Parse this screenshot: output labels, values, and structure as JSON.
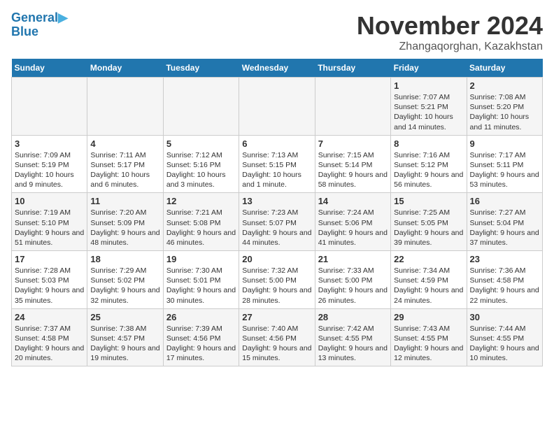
{
  "header": {
    "logo_line1": "General",
    "logo_line2": "Blue",
    "month": "November 2024",
    "location": "Zhangaqorghan, Kazakhstan"
  },
  "weekdays": [
    "Sunday",
    "Monday",
    "Tuesday",
    "Wednesday",
    "Thursday",
    "Friday",
    "Saturday"
  ],
  "weeks": [
    [
      {
        "day": "",
        "info": ""
      },
      {
        "day": "",
        "info": ""
      },
      {
        "day": "",
        "info": ""
      },
      {
        "day": "",
        "info": ""
      },
      {
        "day": "",
        "info": ""
      },
      {
        "day": "1",
        "info": "Sunrise: 7:07 AM\nSunset: 5:21 PM\nDaylight: 10 hours and 14 minutes."
      },
      {
        "day": "2",
        "info": "Sunrise: 7:08 AM\nSunset: 5:20 PM\nDaylight: 10 hours and 11 minutes."
      }
    ],
    [
      {
        "day": "3",
        "info": "Sunrise: 7:09 AM\nSunset: 5:19 PM\nDaylight: 10 hours and 9 minutes."
      },
      {
        "day": "4",
        "info": "Sunrise: 7:11 AM\nSunset: 5:17 PM\nDaylight: 10 hours and 6 minutes."
      },
      {
        "day": "5",
        "info": "Sunrise: 7:12 AM\nSunset: 5:16 PM\nDaylight: 10 hours and 3 minutes."
      },
      {
        "day": "6",
        "info": "Sunrise: 7:13 AM\nSunset: 5:15 PM\nDaylight: 10 hours and 1 minute."
      },
      {
        "day": "7",
        "info": "Sunrise: 7:15 AM\nSunset: 5:14 PM\nDaylight: 9 hours and 58 minutes."
      },
      {
        "day": "8",
        "info": "Sunrise: 7:16 AM\nSunset: 5:12 PM\nDaylight: 9 hours and 56 minutes."
      },
      {
        "day": "9",
        "info": "Sunrise: 7:17 AM\nSunset: 5:11 PM\nDaylight: 9 hours and 53 minutes."
      }
    ],
    [
      {
        "day": "10",
        "info": "Sunrise: 7:19 AM\nSunset: 5:10 PM\nDaylight: 9 hours and 51 minutes."
      },
      {
        "day": "11",
        "info": "Sunrise: 7:20 AM\nSunset: 5:09 PM\nDaylight: 9 hours and 48 minutes."
      },
      {
        "day": "12",
        "info": "Sunrise: 7:21 AM\nSunset: 5:08 PM\nDaylight: 9 hours and 46 minutes."
      },
      {
        "day": "13",
        "info": "Sunrise: 7:23 AM\nSunset: 5:07 PM\nDaylight: 9 hours and 44 minutes."
      },
      {
        "day": "14",
        "info": "Sunrise: 7:24 AM\nSunset: 5:06 PM\nDaylight: 9 hours and 41 minutes."
      },
      {
        "day": "15",
        "info": "Sunrise: 7:25 AM\nSunset: 5:05 PM\nDaylight: 9 hours and 39 minutes."
      },
      {
        "day": "16",
        "info": "Sunrise: 7:27 AM\nSunset: 5:04 PM\nDaylight: 9 hours and 37 minutes."
      }
    ],
    [
      {
        "day": "17",
        "info": "Sunrise: 7:28 AM\nSunset: 5:03 PM\nDaylight: 9 hours and 35 minutes."
      },
      {
        "day": "18",
        "info": "Sunrise: 7:29 AM\nSunset: 5:02 PM\nDaylight: 9 hours and 32 minutes."
      },
      {
        "day": "19",
        "info": "Sunrise: 7:30 AM\nSunset: 5:01 PM\nDaylight: 9 hours and 30 minutes."
      },
      {
        "day": "20",
        "info": "Sunrise: 7:32 AM\nSunset: 5:00 PM\nDaylight: 9 hours and 28 minutes."
      },
      {
        "day": "21",
        "info": "Sunrise: 7:33 AM\nSunset: 5:00 PM\nDaylight: 9 hours and 26 minutes."
      },
      {
        "day": "22",
        "info": "Sunrise: 7:34 AM\nSunset: 4:59 PM\nDaylight: 9 hours and 24 minutes."
      },
      {
        "day": "23",
        "info": "Sunrise: 7:36 AM\nSunset: 4:58 PM\nDaylight: 9 hours and 22 minutes."
      }
    ],
    [
      {
        "day": "24",
        "info": "Sunrise: 7:37 AM\nSunset: 4:58 PM\nDaylight: 9 hours and 20 minutes."
      },
      {
        "day": "25",
        "info": "Sunrise: 7:38 AM\nSunset: 4:57 PM\nDaylight: 9 hours and 19 minutes."
      },
      {
        "day": "26",
        "info": "Sunrise: 7:39 AM\nSunset: 4:56 PM\nDaylight: 9 hours and 17 minutes."
      },
      {
        "day": "27",
        "info": "Sunrise: 7:40 AM\nSunset: 4:56 PM\nDaylight: 9 hours and 15 minutes."
      },
      {
        "day": "28",
        "info": "Sunrise: 7:42 AM\nSunset: 4:55 PM\nDaylight: 9 hours and 13 minutes."
      },
      {
        "day": "29",
        "info": "Sunrise: 7:43 AM\nSunset: 4:55 PM\nDaylight: 9 hours and 12 minutes."
      },
      {
        "day": "30",
        "info": "Sunrise: 7:44 AM\nSunset: 4:55 PM\nDaylight: 9 hours and 10 minutes."
      }
    ]
  ]
}
